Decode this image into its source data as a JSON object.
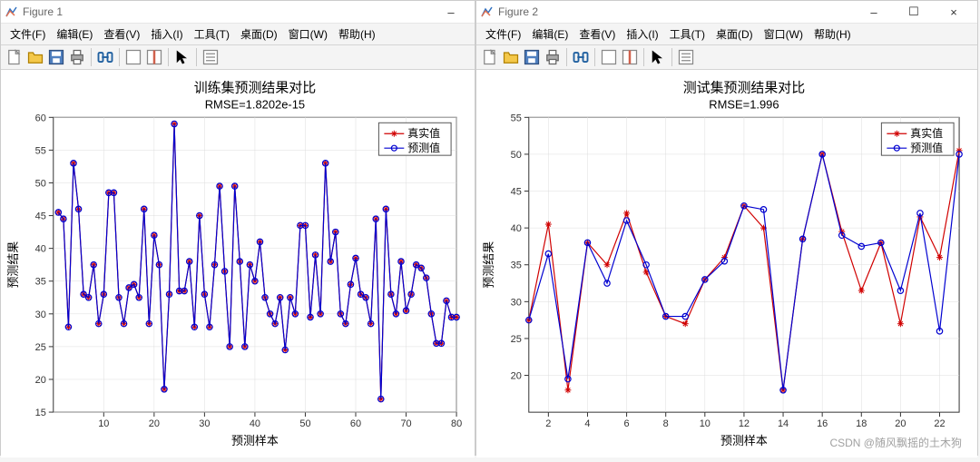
{
  "watermark": "CSDN @随风飘摇的土木狗",
  "windows": [
    {
      "key": "w1",
      "title": "Figure 1",
      "window_buttons": {
        "min": "–",
        "max": "☐",
        "close": "×",
        "has_buttons": false
      },
      "icon_colors": {
        "a": "#e07050",
        "b": "#3070c0"
      },
      "menus": [
        "文件(F)",
        "编辑(E)",
        "查看(V)",
        "插入(I)",
        "工具(T)",
        "桌面(D)",
        "窗口(W)",
        "帮助(H)"
      ],
      "toolbar": [
        "new",
        "open",
        "save",
        "print",
        "|",
        "link",
        "|",
        "win1",
        "win2",
        "|",
        "cursor",
        "|",
        "inspect"
      ],
      "chart": {
        "title": "训练集预测结果对比",
        "subtitle": "RMSE=1.8202e-15",
        "xlabel": "预测样本",
        "ylabel": "预测结果",
        "legend": [
          "真实值",
          "预测值"
        ],
        "xdomain": [
          0,
          80
        ],
        "xticks": [
          10,
          20,
          30,
          40,
          50,
          60,
          70,
          80
        ],
        "ydomain": [
          15,
          60
        ],
        "yticks": [
          15,
          20,
          25,
          30,
          35,
          40,
          45,
          50,
          55,
          60
        ]
      }
    },
    {
      "key": "w2",
      "title": "Figure 2",
      "window_buttons": {
        "min": "–",
        "max": "☐",
        "close": "×",
        "has_buttons": true
      },
      "icon_colors": {
        "a": "#e07050",
        "b": "#3070c0"
      },
      "menus": [
        "文件(F)",
        "编辑(E)",
        "查看(V)",
        "插入(I)",
        "工具(T)",
        "桌面(D)",
        "窗口(W)",
        "帮助(H)"
      ],
      "toolbar": [
        "new",
        "open",
        "save",
        "print",
        "|",
        "link",
        "|",
        "win1",
        "win2",
        "|",
        "cursor",
        "|",
        "inspect"
      ],
      "chart": {
        "title": "测试集预测结果对比",
        "subtitle": "RMSE=1.996",
        "xlabel": "预测样本",
        "ylabel": "预测结果",
        "legend": [
          "真实值",
          "预测值"
        ],
        "xdomain": [
          1,
          23
        ],
        "xticks": [
          2,
          4,
          6,
          8,
          10,
          12,
          14,
          16,
          18,
          20,
          22
        ],
        "ydomain": [
          15,
          55
        ],
        "yticks": [
          20,
          25,
          30,
          35,
          40,
          45,
          50,
          55
        ]
      }
    }
  ],
  "chart_data": [
    {
      "type": "line",
      "title": "训练集预测结果对比",
      "subtitle": "RMSE=1.8202e-15",
      "xlabel": "预测样本",
      "ylabel": "预测结果",
      "xlim": [
        0,
        80
      ],
      "ylim": [
        15,
        60
      ],
      "x": [
        1,
        2,
        3,
        4,
        5,
        6,
        7,
        8,
        9,
        10,
        11,
        12,
        13,
        14,
        15,
        16,
        17,
        18,
        19,
        20,
        21,
        22,
        23,
        24,
        25,
        26,
        27,
        28,
        29,
        30,
        31,
        32,
        33,
        34,
        35,
        36,
        37,
        38,
        39,
        40,
        41,
        42,
        43,
        44,
        45,
        46,
        47,
        48,
        49,
        50,
        51,
        52,
        53,
        54,
        55,
        56,
        57,
        58,
        59,
        60,
        61,
        62,
        63,
        64,
        65,
        66,
        67,
        68,
        69,
        70,
        71,
        72,
        73,
        74,
        75,
        76,
        77,
        78,
        79,
        80
      ],
      "series": [
        {
          "name": "真实值",
          "color": "#d00000",
          "marker": "*",
          "values": [
            45.5,
            44.5,
            28.0,
            53.0,
            46.0,
            33.0,
            32.5,
            37.5,
            28.5,
            33.0,
            48.5,
            48.5,
            32.5,
            28.5,
            34.0,
            34.5,
            32.5,
            46.0,
            28.5,
            42.0,
            37.5,
            18.5,
            33.0,
            59.0,
            33.5,
            33.5,
            38.0,
            28.0,
            45.0,
            33.0,
            28.0,
            37.5,
            49.5,
            36.5,
            25.0,
            49.5,
            38.0,
            25.0,
            37.5,
            35.0,
            41.0,
            32.5,
            30.0,
            28.5,
            32.5,
            24.5,
            32.5,
            30.0,
            43.5,
            43.5,
            29.5,
            39.0,
            30.0,
            53.0,
            38.0,
            42.5,
            30.0,
            28.5,
            34.5,
            38.5,
            33.0,
            32.5,
            28.5,
            44.5,
            17.0,
            46.0,
            33.0,
            30.0,
            38.0,
            30.5,
            33.0,
            37.5,
            37.0,
            35.5,
            30.0,
            25.5,
            25.5,
            32.0,
            29.5,
            29.5
          ]
        },
        {
          "name": "预测值",
          "color": "#0000d0",
          "marker": "o",
          "values": [
            45.5,
            44.5,
            28.0,
            53.0,
            46.0,
            33.0,
            32.5,
            37.5,
            28.5,
            33.0,
            48.5,
            48.5,
            32.5,
            28.5,
            34.0,
            34.5,
            32.5,
            46.0,
            28.5,
            42.0,
            37.5,
            18.5,
            33.0,
            59.0,
            33.5,
            33.5,
            38.0,
            28.0,
            45.0,
            33.0,
            28.0,
            37.5,
            49.5,
            36.5,
            25.0,
            49.5,
            38.0,
            25.0,
            37.5,
            35.0,
            41.0,
            32.5,
            30.0,
            28.5,
            32.5,
            24.5,
            32.5,
            30.0,
            43.5,
            43.5,
            29.5,
            39.0,
            30.0,
            53.0,
            38.0,
            42.5,
            30.0,
            28.5,
            34.5,
            38.5,
            33.0,
            32.5,
            28.5,
            44.5,
            17.0,
            46.0,
            33.0,
            30.0,
            38.0,
            30.5,
            33.0,
            37.5,
            37.0,
            35.5,
            30.0,
            25.5,
            25.5,
            32.0,
            29.5,
            29.5
          ]
        }
      ]
    },
    {
      "type": "line",
      "title": "测试集预测结果对比",
      "subtitle": "RMSE=1.996",
      "xlabel": "预测样本",
      "ylabel": "预测结果",
      "xlim": [
        1,
        23
      ],
      "ylim": [
        15,
        55
      ],
      "x": [
        1,
        2,
        3,
        4,
        5,
        6,
        7,
        8,
        9,
        10,
        11,
        12,
        13,
        14,
        15,
        16,
        17,
        18,
        19,
        20,
        21,
        22,
        23
      ],
      "series": [
        {
          "name": "真实值",
          "color": "#d00000",
          "marker": "*",
          "values": [
            27.5,
            40.5,
            18.0,
            38.0,
            35.0,
            42.0,
            34.0,
            28.0,
            27.0,
            33.0,
            36.0,
            43.0,
            40.0,
            18.0,
            38.5,
            50.0,
            39.5,
            31.5,
            38.0,
            27.0,
            41.5,
            36.0,
            50.5
          ]
        },
        {
          "name": "预测值",
          "color": "#0000d0",
          "marker": "o",
          "values": [
            27.5,
            36.5,
            19.5,
            38.0,
            32.5,
            41.0,
            35.0,
            28.0,
            28.0,
            33.0,
            35.5,
            43.0,
            42.5,
            18.0,
            38.5,
            50.0,
            39.0,
            37.5,
            38.0,
            31.5,
            42.0,
            26.0,
            50.0
          ]
        }
      ]
    }
  ]
}
